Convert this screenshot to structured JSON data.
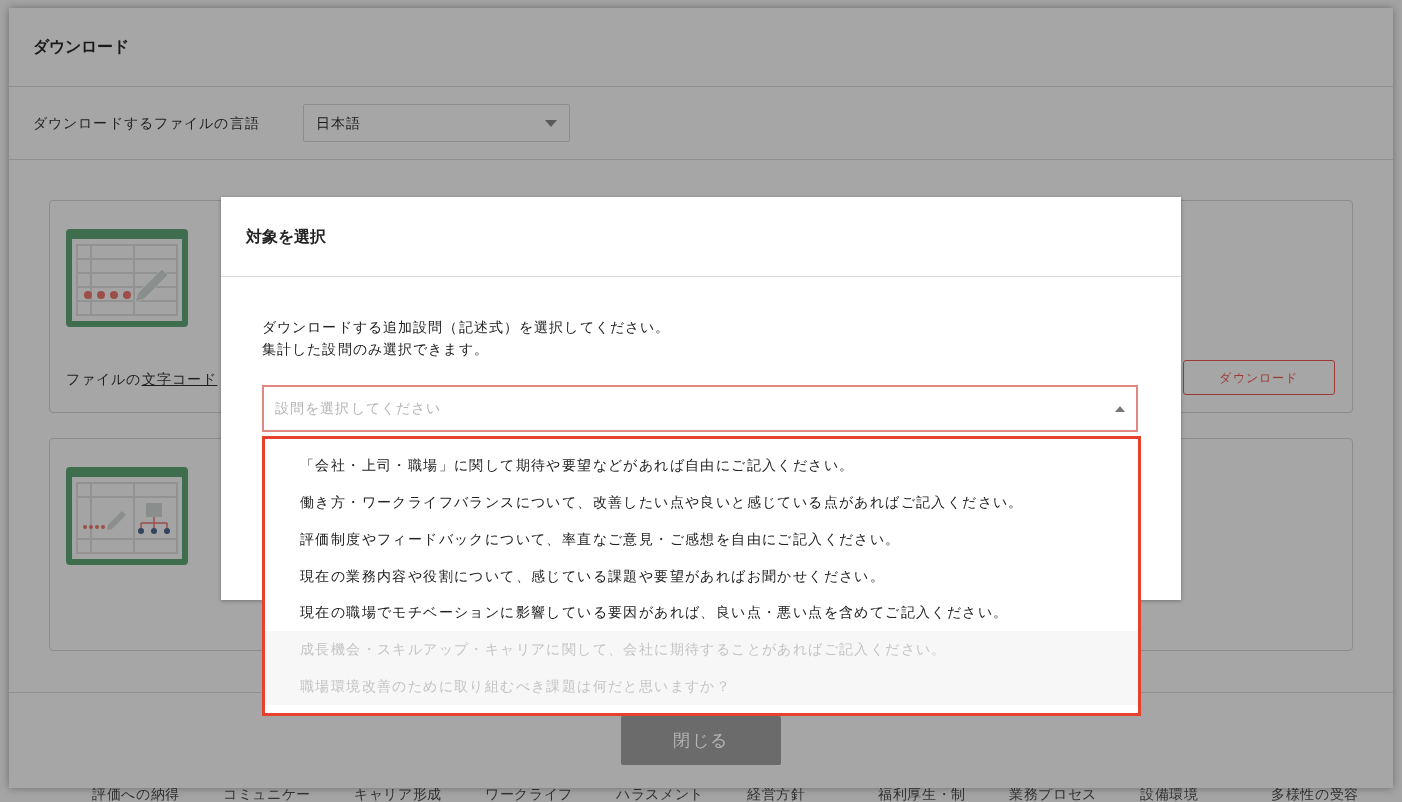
{
  "background_tabs": [
    "評価への納得",
    "コミュニケー",
    "キャリア形成",
    "ワークライフ",
    "ハラスメント",
    "経営方針",
    "福利厚生・制",
    "業務プロセス",
    "設備環境",
    "多様性の受容"
  ],
  "download_dialog": {
    "title": "ダウンロード",
    "language_label": "ダウンロードするファイルの言語",
    "language_value": "日本語",
    "cards": [
      {
        "kind": "text",
        "charset_prefix": "ファイルの",
        "charset_link": "文字コード",
        "button": "ダウンロード"
      },
      {
        "kind": "org"
      }
    ],
    "close_button": "閉じる"
  },
  "select_dialog": {
    "title": "対象を選択",
    "description": [
      "ダウンロードする追加設問（記述式）を選択してください。",
      "集計した設問のみ選択できます。"
    ],
    "select": {
      "placeholder": "設問を選択してください",
      "expanded": true
    },
    "options": [
      {
        "label": "「会社・上司・職場」に関して期待や要望などがあれば自由にご記入ください。",
        "disabled": false
      },
      {
        "label": "働き方・ワークライフバランスについて、改善したい点や良いと感じている点があればご記入ください。",
        "disabled": false
      },
      {
        "label": "評価制度やフィードバックについて、率直なご意見・ご感想を自由にご記入ください。",
        "disabled": false
      },
      {
        "label": "現在の業務内容や役割について、感じている課題や要望があればお聞かせください。",
        "disabled": false
      },
      {
        "label": "現在の職場でモチベーションに影響している要因があれば、良い点・悪い点を含めてご記入ください。",
        "disabled": false
      },
      {
        "label": "成長機会・スキルアップ・キャリアに関して、会社に期待することがあればご記入ください。",
        "disabled": true
      },
      {
        "label": "職場環境改善のために取り組むべき課題は何だと思いますか？",
        "disabled": true
      }
    ]
  }
}
